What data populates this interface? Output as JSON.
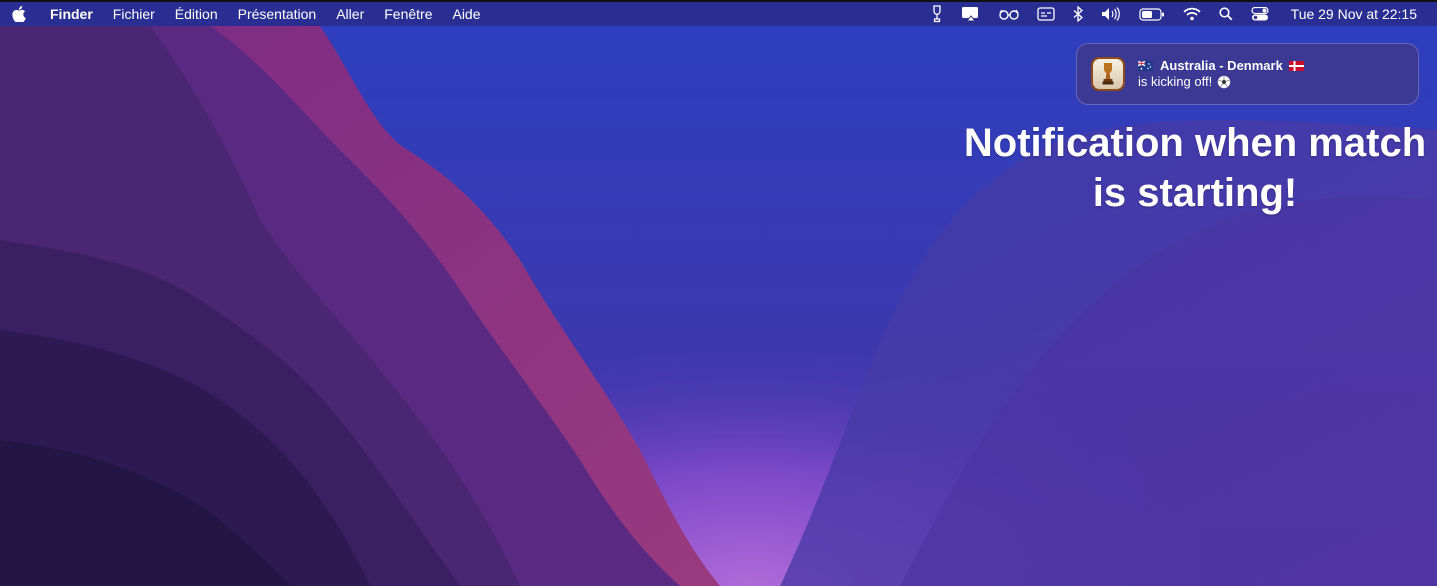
{
  "menu_bar": {
    "app_name": "Finder",
    "items": [
      "Fichier",
      "Édition",
      "Présentation",
      "Aller",
      "Fenêtre",
      "Aide"
    ],
    "status_icons": [
      "trophy-icon",
      "screen-mirroring-icon",
      "glasses-icon",
      "caption-icon",
      "bluetooth-icon",
      "volume-icon",
      "battery-icon",
      "wifi-icon",
      "search-icon",
      "control-center-icon"
    ],
    "clock": "Tue 29 Nov at  22:15"
  },
  "notification": {
    "title": "Australia - Denmark",
    "body": "is kicking off!",
    "flags": [
      "australia-flag",
      "denmark-flag"
    ]
  },
  "headline": {
    "line1": "Notification when match",
    "line2": "is starting!"
  },
  "colors": {
    "sky_top": "#2c3fbf",
    "purple_glow": "#8a4fd0",
    "magenta_ridge": "#8e2f80",
    "deep_violet": "#2a1a55"
  }
}
